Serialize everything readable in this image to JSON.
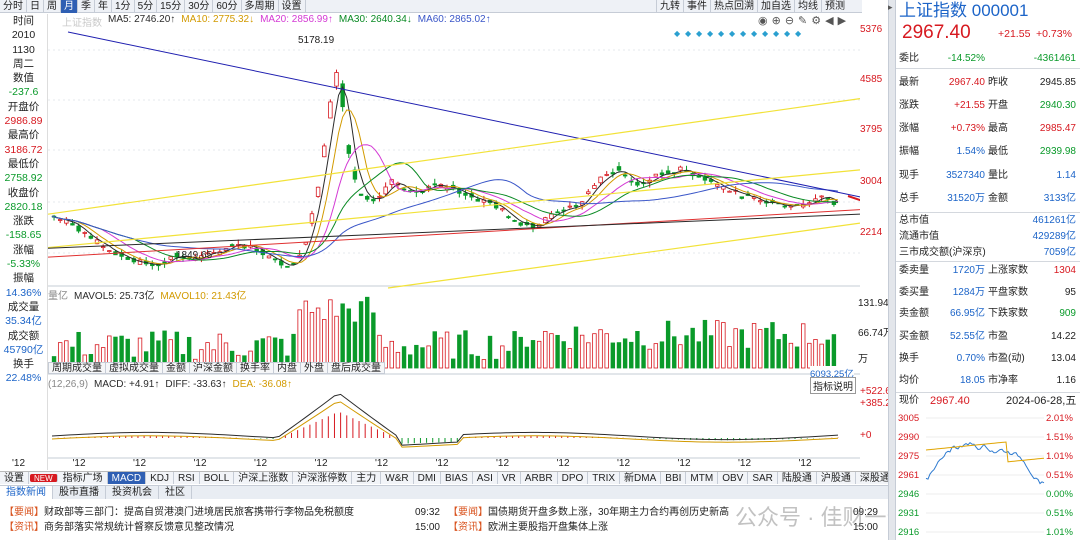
{
  "toolbar": {
    "periods": [
      "分时",
      "日",
      "周",
      "月",
      "季",
      "年",
      "1分",
      "5分",
      "15分",
      "30分",
      "60分",
      "多周期",
      "设置"
    ],
    "active_period": "月",
    "right_tools": [
      "九转",
      "事件",
      "热点回溯",
      "加自选",
      "均线",
      "预测"
    ]
  },
  "ma_legend": {
    "name": "上证指数",
    "ma5": "MA5: 2746.20↑",
    "ma10": "MA10: 2775.32↓",
    "ma20": "MA20: 2856.99↑",
    "ma30": "MA30: 2640.34↓",
    "ma60": "MA60: 2865.02↑",
    "colors": {
      "ma5": "#2b2b2b",
      "ma10": "#d29a00",
      "ma20": "#d43ad4",
      "ma30": "#0a8a24",
      "ma60": "#3a56c8"
    }
  },
  "left_info": [
    {
      "label": "时间",
      "value": "2010",
      "value2": "1130",
      "value3": "周二"
    },
    {
      "label": "数值",
      "value": "-237.6",
      "color": "green"
    },
    {
      "label": "开盘价",
      "value": "2986.89",
      "color": "red"
    },
    {
      "label": "最高价",
      "value": "3186.72",
      "color": "red"
    },
    {
      "label": "最低价",
      "value": "2758.92",
      "color": "green"
    },
    {
      "label": "收盘价",
      "value": "2820.18",
      "color": "green"
    },
    {
      "label": "涨跌",
      "value": "-158.65",
      "color": "green"
    },
    {
      "label": "涨幅",
      "value": "-5.33%",
      "color": "green"
    },
    {
      "label": "振幅",
      "value": "14.36%",
      "color": "blue"
    },
    {
      "label": "成交量",
      "value": "35.34亿",
      "color": "blue"
    },
    {
      "label": "成交额",
      "value": "45790亿",
      "color": "blue"
    },
    {
      "label": "换手",
      "value": "22.48%",
      "color": "blue"
    }
  ],
  "price_axis": [
    "5376",
    "4585",
    "3795",
    "3004",
    "2214"
  ],
  "annotations": {
    "high": "5178.19",
    "low": "1849.65"
  },
  "volume_legend": {
    "vol": "量亿",
    "mavol5": "MAVOL5: 25.73亿",
    "mavol10": "MAVOL10: 21.43亿",
    "axis_top": "131.94万",
    "axis_mid": "66.74万",
    "last": "6093.25亿",
    "unit": "万"
  },
  "volume_subtabs": [
    "周期成交量",
    "虚拟成交量",
    "金额",
    "沪深金额",
    "换手率",
    "内盘",
    "外盘",
    "盘后成交量"
  ],
  "macd_legend": {
    "params": "(12,26,9)",
    "macd": "MACD: +4.91↑",
    "diff": "DIFF: -33.63↑",
    "dea": "DEA: -36.08↑",
    "help": "指标说明",
    "axis_top": "+522.6",
    "axis_mid": "+385.2",
    "axis_zero": "+0"
  },
  "x_labels": [
    "'12",
    "'12",
    "'12",
    "'12",
    "'12",
    "'12",
    "'12",
    "'12",
    "'12",
    "'12",
    "'12",
    "'12",
    "'12",
    "'12"
  ],
  "indicator_tabs": [
    "设置",
    "NEW",
    "指标广场",
    "MACD",
    "KDJ",
    "RSI",
    "BOLL",
    "沪深上涨数",
    "沪深涨停数",
    "主力",
    "W&R",
    "DMI",
    "BIAS",
    "ASI",
    "VR",
    "ARBR",
    "DPO",
    "TRIX",
    "新DMA",
    "BBI",
    "MTM",
    "OBV",
    "SAR",
    "陆股通",
    "沪股通",
    "深股通"
  ],
  "active_indicator": "MACD",
  "news_tabs": [
    "指数新闻",
    "股市直播",
    "投资机会",
    "社区"
  ],
  "news_left": [
    {
      "tag": "【要闻】",
      "title": "财政部等三部门：提高自贸港澳门进境居民旅客携带行李物品免税额度",
      "time": "09:32"
    },
    {
      "tag": "【资讯】",
      "title": "商务部落实常规统计督察反馈意见整改情况",
      "time": "15:00"
    }
  ],
  "news_right": [
    {
      "tag": "【要闻】",
      "title": "国债期货开盘多数上涨，30年期主力合约再创历史新高",
      "time": "09:29"
    },
    {
      "tag": "【资讯】",
      "title": "欧洲主要股指开盘集体上涨",
      "time": "15:00"
    }
  ],
  "watermark": "公众号 · 佳财一分钟",
  "right_panel": {
    "title": "上证指数",
    "code": "000001",
    "price": "2967.40",
    "change": "+21.55",
    "pct": "+0.73%",
    "rows": [
      [
        {
          "k": "委比",
          "v": "-14.52%",
          "c": "grn"
        },
        {
          "k": "",
          "v": "-4361461",
          "c": "grn"
        }
      ],
      [
        {
          "k": "最新",
          "v": "2967.40",
          "c": "red"
        },
        {
          "k": "昨收",
          "v": "2945.85",
          "c": ""
        }
      ],
      [
        {
          "k": "涨跌",
          "v": "+21.55",
          "c": "red"
        },
        {
          "k": "开盘",
          "v": "2940.30",
          "c": "grn"
        }
      ],
      [
        {
          "k": "涨幅",
          "v": "+0.73%",
          "c": "red"
        },
        {
          "k": "最高",
          "v": "2985.47",
          "c": "red"
        }
      ],
      [
        {
          "k": "振幅",
          "v": "1.54%",
          "c": "blu"
        },
        {
          "k": "最低",
          "v": "2939.98",
          "c": "grn"
        }
      ],
      [
        {
          "k": "现手",
          "v": "3527340",
          "c": "blu"
        },
        {
          "k": "量比",
          "v": "1.14",
          "c": "blu"
        }
      ],
      [
        {
          "k": "总手",
          "v": "31520万",
          "c": "blu"
        },
        {
          "k": "金额",
          "v": "3133亿",
          "c": "blu"
        }
      ]
    ],
    "market": [
      {
        "k": "总市值",
        "v": "461261亿"
      },
      {
        "k": "流通市值",
        "v": "429289亿"
      },
      {
        "k": "三市成交额(沪深京)",
        "v": "7059亿"
      }
    ],
    "rows2": [
      [
        {
          "k": "委卖量",
          "v": "1720万",
          "c": "blu"
        },
        {
          "k": "上涨家数",
          "v": "1304",
          "c": "red"
        }
      ],
      [
        {
          "k": "委买量",
          "v": "1284万",
          "c": "blu"
        },
        {
          "k": "平盘家数",
          "v": "95",
          "c": ""
        }
      ],
      [
        {
          "k": "卖金额",
          "v": "66.95亿",
          "c": "blu"
        },
        {
          "k": "下跌家数",
          "v": "909",
          "c": "grn"
        }
      ],
      [
        {
          "k": "买金额",
          "v": "52.55亿",
          "c": "blu"
        },
        {
          "k": "市盈",
          "v": "14.22",
          "c": ""
        }
      ],
      [
        {
          "k": "换手",
          "v": "0.70%",
          "c": "blu"
        },
        {
          "k": "市盈(动)",
          "v": "13.04",
          "c": ""
        }
      ],
      [
        {
          "k": "均价",
          "v": "18.05",
          "c": "blu"
        },
        {
          "k": "市净率",
          "v": "1.16",
          "c": ""
        }
      ]
    ],
    "intraday": {
      "label": "现价",
      "price": "2967.40",
      "date": "2024-06-28,五",
      "left_ticks": [
        "3005",
        "2990",
        "2975",
        "2961",
        "2946",
        "2931",
        "2916"
      ],
      "right_ticks": [
        "2.01%",
        "1.51%",
        "1.01%",
        "0.51%",
        "0.00%",
        "0.51%",
        "1.01%"
      ]
    }
  }
}
